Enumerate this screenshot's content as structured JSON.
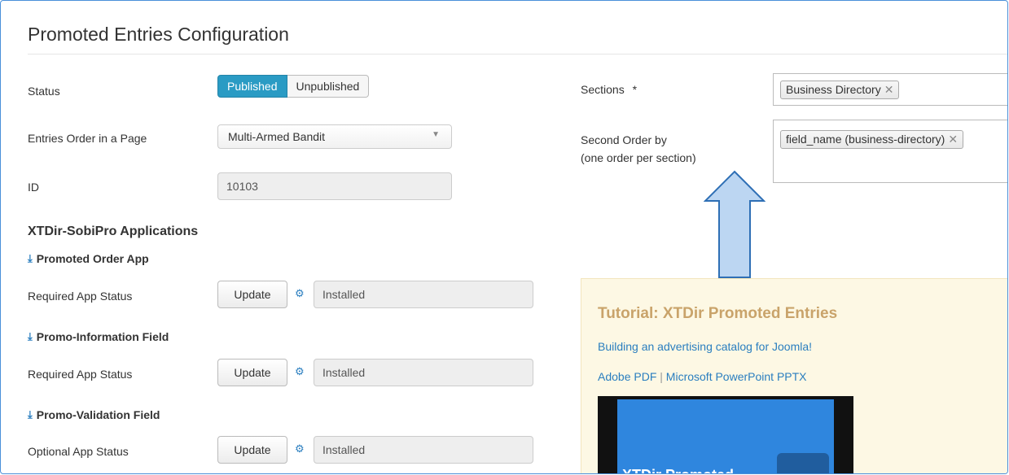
{
  "title": "Promoted Entries Configuration",
  "status": {
    "label": "Status",
    "options": [
      "Published",
      "Unpublished"
    ],
    "selected": "Published"
  },
  "order": {
    "label": "Entries Order in a Page",
    "value": "Multi-Armed Bandit"
  },
  "id": {
    "label": "ID",
    "value": "10103"
  },
  "apps": {
    "heading": "XTDir-SobiPro Applications",
    "items": [
      {
        "name": "Promoted Order App",
        "status_label": "Required App Status",
        "button": "Update",
        "status": "Installed"
      },
      {
        "name": "Promo-Information Field",
        "status_label": "Required App Status",
        "button": "Update",
        "status": "Installed"
      },
      {
        "name": "Promo-Validation Field",
        "status_label": "Optional App Status",
        "button": "Update",
        "status": "Installed"
      }
    ]
  },
  "sections": {
    "label": "Sections",
    "required_mark": "*",
    "tags": [
      "Business Directory"
    ],
    "remove_glyph": "✕"
  },
  "second_order": {
    "label_line1": "Second Order by",
    "label_line2": "(one order per section)",
    "tags": [
      "field_name (business-directory)"
    ]
  },
  "tutorial": {
    "title": "Tutorial: XTDir Promoted Entries",
    "subtitle": "Building an advertising catalog for Joomla!",
    "link1": "Adobe PDF",
    "separator": "|",
    "link2": "Microsoft PowerPoint PPTX",
    "video_text": "XTDir Promoted"
  },
  "icons": {
    "download": "download-icon",
    "gears": "gears-icon",
    "arrow": "up-arrow-annotation"
  },
  "colors": {
    "accent": "#2a9bc4",
    "link": "#2a7ebf",
    "tutorial_bg": "#fdf8e4",
    "tutorial_title": "#c9a36a"
  }
}
